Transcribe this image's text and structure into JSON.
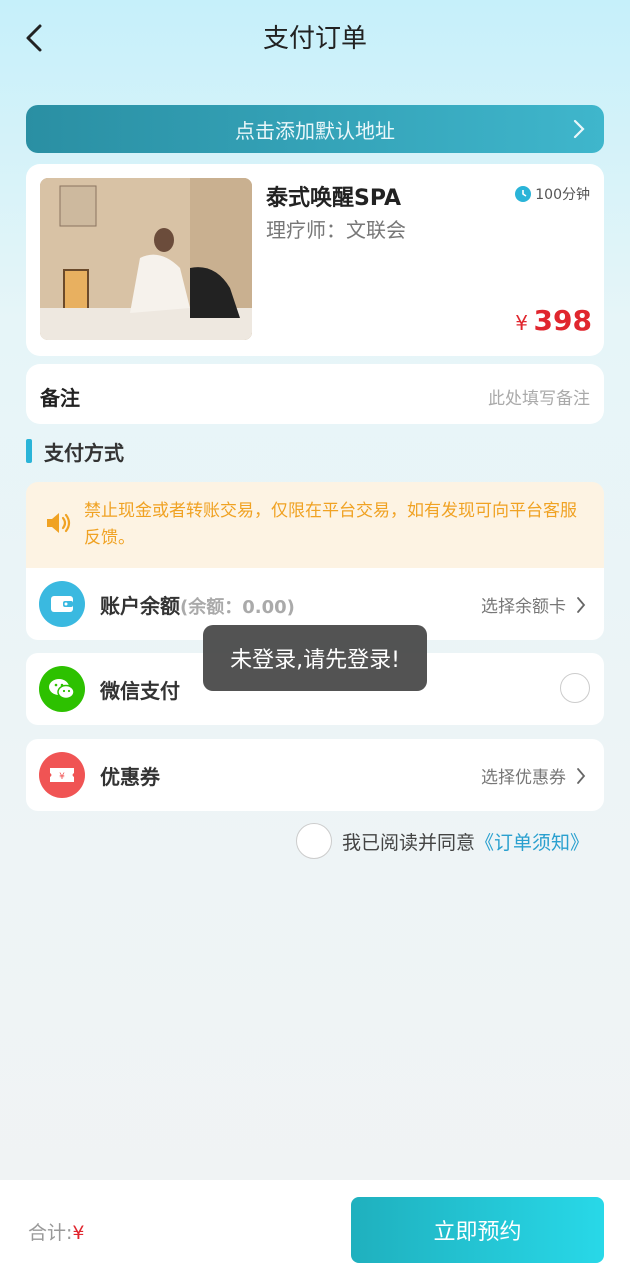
{
  "header": {
    "title": "支付订单",
    "back_icon": "chevron-left-icon"
  },
  "address": {
    "label": "点击添加默认地址",
    "chevron_icon": "chevron-right-icon"
  },
  "product": {
    "name": "泰式唤醒SPA",
    "technician": "理疗师：文联会",
    "duration": "100分钟",
    "currency": "¥",
    "price": "398"
  },
  "remark": {
    "label": "备注",
    "placeholder": "此处填写备注"
  },
  "payment": {
    "section_title": "支付方式",
    "notice": "禁止现金或者转账交易，仅限在平台交易，如有发现可向平台客服反馈。",
    "balance": {
      "label": "账户余额",
      "sub": "(余额：0.00)",
      "action": "选择余额卡"
    },
    "wechat": {
      "label": "微信支付"
    },
    "coupon": {
      "label": "优惠券",
      "action": "选择优惠券"
    }
  },
  "agreement": {
    "text": "我已阅读并同意",
    "link": "《订单须知》"
  },
  "toast": "未登录,请先登录!",
  "footer": {
    "total_label": "合计:",
    "currency": "¥",
    "submit": "立即预约"
  },
  "colors": {
    "accent": "#2ab4d8",
    "price": "#e0262e",
    "notice": "#f0a223",
    "wechat": "#2dc100",
    "coupon": "#f05454"
  }
}
